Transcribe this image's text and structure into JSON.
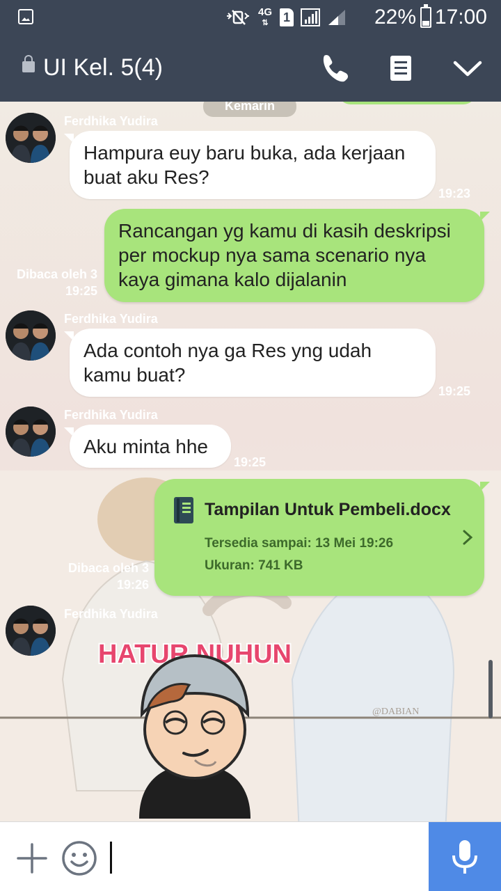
{
  "status_bar": {
    "network": "4G",
    "sim": "1",
    "battery": "22%",
    "time": "17:00",
    "icons": [
      "image-icon",
      "mute-icon",
      "signal-icon",
      "battery-icon"
    ]
  },
  "header": {
    "title": "UI Kel. 5(4)",
    "icons": [
      "lock-icon",
      "phone-icon",
      "notes-icon",
      "chevron-down-icon"
    ]
  },
  "chat": {
    "date_label": "Kemarin",
    "messages": [
      {
        "sender": "Ferdhika Yudira",
        "text_lines": [
          "Hampura euy baru buka, ada kerjaan",
          "buat aku Res?"
        ],
        "time": "19:23"
      },
      {
        "sender": "me",
        "text_lines": [
          "Rancangan yg kamu di kasih deskripsi",
          "per mockup nya sama scenario nya",
          "kaya gimana kalo dijalanin"
        ],
        "read": "Dibaca oleh 3",
        "time": "19:25"
      },
      {
        "sender": "Ferdhika Yudira",
        "text_lines": [
          "Ada contoh nya ga Res yng udah",
          "kamu buat?"
        ],
        "time": "19:25"
      },
      {
        "sender": "Ferdhika Yudira",
        "text_lines": [
          "Aku minta hhe"
        ],
        "time": "19:25"
      },
      {
        "sender": "me",
        "file": {
          "name": "Tampilan Untuk Pembeli.docx",
          "available": "Tersedia sampai: 13 Mei 19:26",
          "size": "Ukuran: 741 KB"
        },
        "read": "Dibaca oleh 3",
        "time": "19:26"
      },
      {
        "sender": "Ferdhika Yudira",
        "sticker_text": "HATUR NUHUN"
      }
    ],
    "background_watermark": "@DABIAN"
  },
  "input_bar": {
    "placeholder": "",
    "icons": [
      "plus-icon",
      "emoji-icon",
      "mic-icon"
    ]
  },
  "colors": {
    "header": "#3c4656",
    "outgoing": "#a8e47c",
    "incoming": "#ffffff",
    "mic_button": "#4f8ae6"
  }
}
